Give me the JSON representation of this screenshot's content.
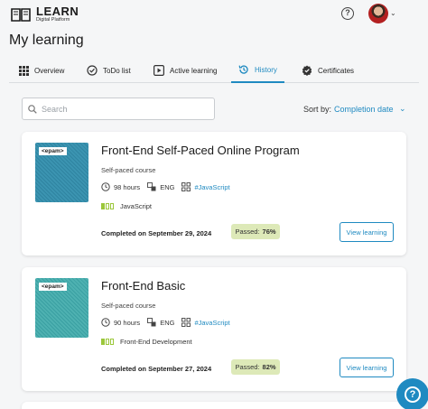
{
  "header": {
    "logo_title": "LEARN",
    "logo_subtitle": "Digital Platform",
    "help_icon": "?",
    "avatar_caret": "⌄"
  },
  "page_title": "My learning",
  "tabs": [
    {
      "label": "Overview",
      "icon": "grid-icon"
    },
    {
      "label": "ToDo list",
      "icon": "check-circle-icon"
    },
    {
      "label": "Active learning",
      "icon": "play-icon"
    },
    {
      "label": "History",
      "icon": "history-icon",
      "active": true
    },
    {
      "label": "Certificates",
      "icon": "certificate-icon"
    }
  ],
  "search": {
    "placeholder": "Search"
  },
  "sort": {
    "label": "Sort by:",
    "value": "Completion date",
    "caret": "⌄"
  },
  "cards": [
    {
      "badge": "<epam>",
      "title": "Front-End Self-Paced Online Program",
      "type": "Self-paced course",
      "duration": "98 hours",
      "language": "ENG",
      "tag": "#JavaScript",
      "skill": "JavaScript",
      "completed": "Completed on September 29, 2024",
      "passed_label": "Passed:",
      "passed_value": "76%",
      "button": "View learning"
    },
    {
      "badge": "<epam>",
      "title": "Front-End Basic",
      "type": "Self-paced course",
      "duration": "90 hours",
      "language": "ENG",
      "tag": "#JavaScript",
      "skill": "Front-End Development",
      "completed": "Completed on September 27, 2024",
      "passed_label": "Passed:",
      "passed_value": "82%",
      "button": "View learning"
    }
  ],
  "help_fab": "?",
  "colors": {
    "accent": "#1f8ac1",
    "passed_bg": "#dde9b8",
    "level_green": "#9bc73a"
  }
}
